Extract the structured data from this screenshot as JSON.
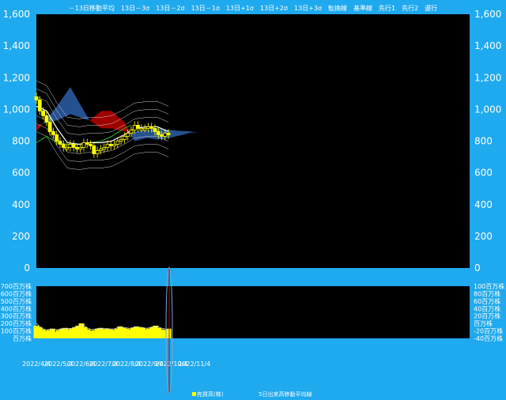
{
  "chart_data": [
    {
      "type": "candlestick-ichimoku",
      "legend": [
        "－13日移動平均",
        "13日－3σ",
        "13日－2σ",
        "13日－1σ",
        "13日+1σ",
        "13日+2σ",
        "13日+3σ",
        "転換線",
        "基準線",
        "先行1",
        "先行2",
        "遅行"
      ],
      "y_ticks": [
        "0",
        "200",
        "400",
        "600",
        "800",
        "1,000",
        "1,200",
        "1,400",
        "1,600"
      ],
      "ylim": [
        0,
        1600
      ],
      "grid": false,
      "colors": {
        "background": "#000000",
        "frame": "#1fa9ee",
        "candle": "#ffff00",
        "kumo_bull": "#2a5aa0",
        "kumo_bear": "#b00000",
        "ma": "#ffffff",
        "band": "#d0d0d0",
        "lagging": "#30b030",
        "cursor": "#c00000"
      },
      "series": [
        {
          "name": "－13日移動平均",
          "x": [
            "2022/4/4",
            "2022/4/18",
            "2022/5/2",
            "2022/5/16",
            "2022/6/1",
            "2022/6/15",
            "2022/7/1",
            "2022/7/15",
            "2022/8/1",
            "2022/8/15",
            "2022/9/1",
            "2022/9/15",
            "2022/9/30"
          ],
          "values": [
            1020,
            990,
            880,
            790,
            780,
            790,
            790,
            800,
            840,
            880,
            890,
            890,
            860
          ]
        },
        {
          "name": "先行1",
          "x": [
            "2022/4/4",
            "2022/5/2",
            "2022/5/20",
            "2022/6/15",
            "2022/7/1",
            "2022/7/15",
            "2022/8/1",
            "2022/8/15",
            "2022/9/1",
            "2022/9/15",
            "2022/10/1",
            "2022/10/15",
            "2022/11/1",
            "2022/11/10"
          ],
          "values": [
            860,
            1020,
            1140,
            930,
            880,
            880,
            860,
            860,
            870,
            880,
            870,
            865,
            860,
            850
          ]
        },
        {
          "name": "先行2",
          "x": [
            "2022/4/4",
            "2022/5/2",
            "2022/5/20",
            "2022/6/15",
            "2022/7/1",
            "2022/7/15",
            "2022/8/1",
            "2022/8/15",
            "2022/9/1",
            "2022/9/15",
            "2022/10/1",
            "2022/10/15",
            "2022/11/1",
            "2022/11/10"
          ],
          "values": [
            900,
            930,
            970,
            930,
            990,
            990,
            920,
            800,
            820,
            810,
            820,
            835,
            855,
            850
          ]
        },
        {
          "name": "遅行",
          "x": [
            "2022/4/4",
            "2022/4/18",
            "2022/5/2",
            "2022/5/16",
            "2022/6/1",
            "2022/6/15",
            "2022/7/1",
            "2022/7/15",
            "2022/8/1",
            "2022/8/10"
          ],
          "values": [
            790,
            830,
            790,
            780,
            780,
            790,
            800,
            830,
            880,
            900
          ]
        }
      ],
      "candles": {
        "x_start": "2022/4/4",
        "x_end": "2022/9/30",
        "close": [
          1060,
          990,
          960,
          920,
          860,
          840,
          800,
          780,
          760,
          760,
          780,
          760,
          750,
          760,
          790,
          780,
          770,
          720,
          740,
          750,
          760,
          780,
          770,
          780,
          800,
          810,
          830,
          850,
          870,
          900,
          880,
          880,
          880,
          890,
          880,
          860,
          840,
          830,
          850,
          840
        ]
      }
    },
    {
      "type": "bar",
      "series": [
        {
          "name": "売買高(株)",
          "values": [
            170,
            150,
            120,
            100,
            110,
            130,
            90,
            110,
            130,
            140,
            120,
            130,
            150,
            170,
            200,
            150,
            120,
            100,
            110,
            130,
            140,
            120,
            130,
            120,
            110,
            130,
            160,
            140,
            130,
            120,
            140,
            160,
            150,
            140,
            120,
            130,
            150,
            170,
            140,
            120,
            110,
            130
          ]
        },
        {
          "name": "5日出来高移動平均線",
          "values": [
            200,
            160,
            130,
            115,
            120,
            125,
            115,
            120,
            130,
            135,
            130,
            135,
            150,
            165,
            180,
            165,
            135,
            120,
            120,
            130,
            135,
            130,
            130,
            125,
            125,
            140,
            150,
            145,
            140,
            135,
            145,
            155,
            150,
            145,
            135,
            140,
            155,
            160,
            150,
            135,
            125,
            120
          ]
        }
      ],
      "y_left_ticks": [
        "百万株",
        "100百万株",
        "200百万株",
        "300百万株",
        "400百万株",
        "500百万株",
        "600百万株",
        "700百万株"
      ],
      "y_right_ticks": [
        "-40百万株",
        "-20百万株",
        "百万株",
        "20百万株",
        "40百万株",
        "60百万株",
        "80百万株",
        "100百万株"
      ],
      "x_ticks": [
        "2022/4/4",
        "2022/5/4",
        "2022/6/4",
        "2022/7/4",
        "2022/8/4",
        "2022/9/4",
        "2022/10/4",
        "2022/11/4"
      ],
      "ylim": [
        0,
        700
      ]
    }
  ]
}
